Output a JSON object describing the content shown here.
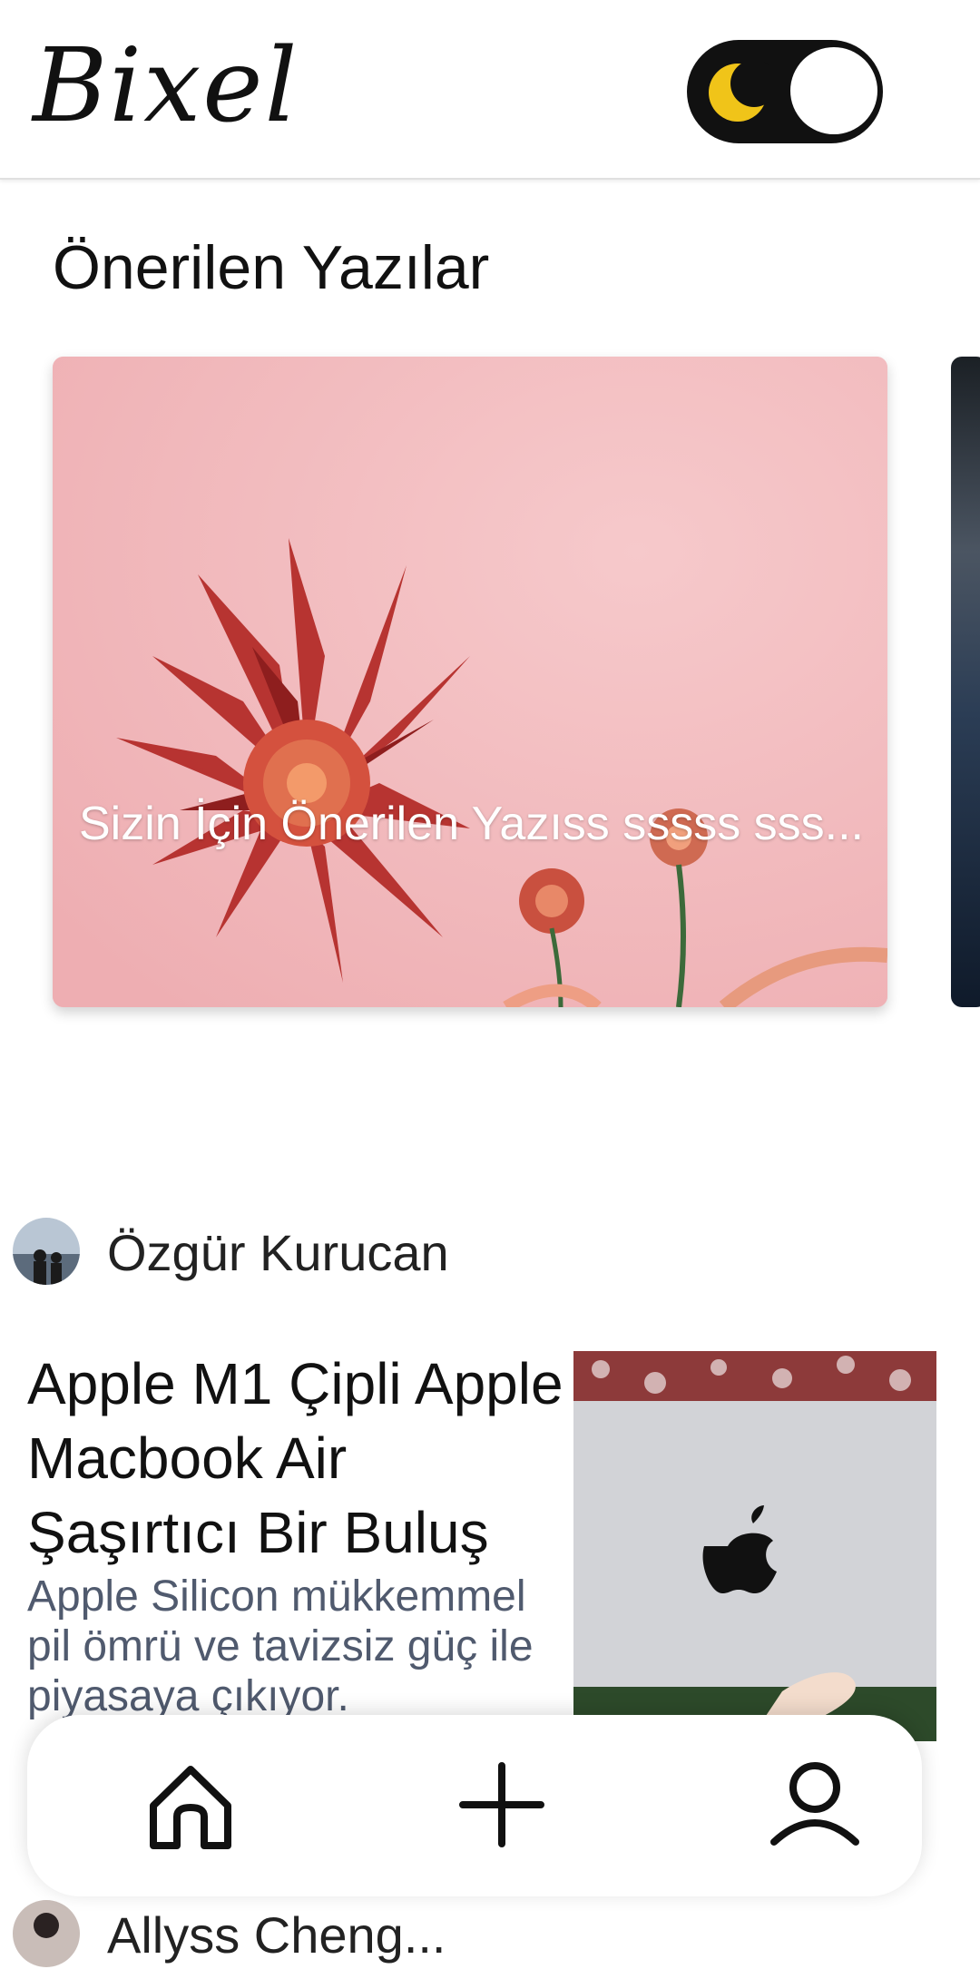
{
  "header": {
    "logo": "Bixel",
    "theme_toggle_icon": "moon-icon",
    "accent": "#f0c419"
  },
  "recommended": {
    "title": "Önerilen Yazılar",
    "cards": [
      {
        "title": "Sizin İçin Önerilen Yazıss sssss sss..."
      }
    ]
  },
  "posts": [
    {
      "author": "Özgür Kurucan",
      "title": "Apple M1 Çipli Apple Macbook Air Şaşırtıcı Bir Buluş",
      "description": "Apple Silicon mükkemmel pil ömrü ve tavizsiz güç ile piyasaya çıkıyor."
    },
    {
      "author": "Allyss Cheng..."
    }
  ],
  "nav": {
    "items": [
      {
        "icon": "home-icon"
      },
      {
        "icon": "plus-icon"
      },
      {
        "icon": "user-icon"
      }
    ]
  }
}
